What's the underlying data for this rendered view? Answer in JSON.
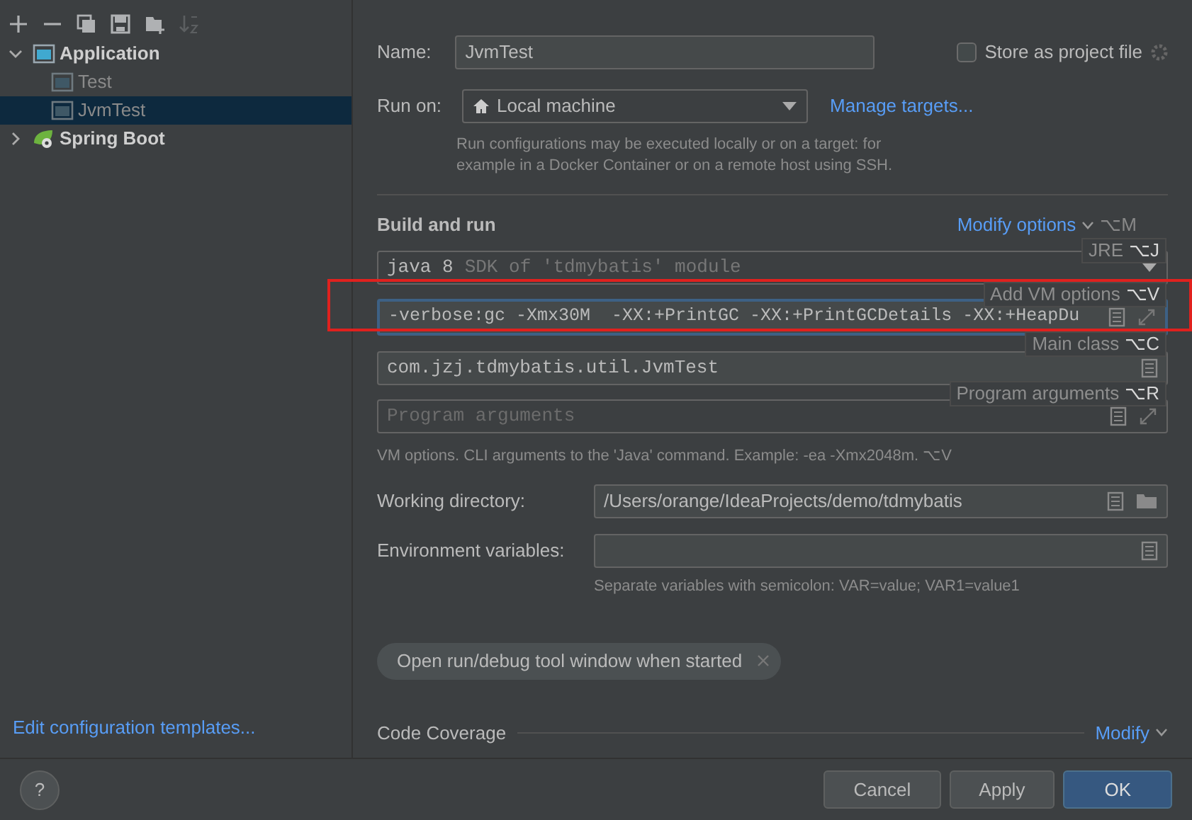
{
  "toolbar": [
    {
      "kind": "add",
      "disabled": false
    },
    {
      "kind": "remove",
      "disabled": false
    },
    {
      "kind": "copy",
      "disabled": false
    },
    {
      "kind": "save",
      "disabled": false
    },
    {
      "kind": "folder",
      "disabled": false
    },
    {
      "kind": "sort",
      "disabled": true
    }
  ],
  "tree": [
    {
      "label": "Application",
      "kind": "application",
      "expanded": true,
      "children": [
        {
          "label": "Test",
          "kind": "application",
          "selected": false
        },
        {
          "label": "JvmTest",
          "kind": "application",
          "selected": true
        }
      ]
    },
    {
      "label": "Spring Boot",
      "kind": "spring",
      "expanded": false
    }
  ],
  "templates_link": "Edit configuration templates...",
  "name": {
    "label": "Name:",
    "value": "JvmTest"
  },
  "store": {
    "label": "Store as project file",
    "checked": false
  },
  "run_on": {
    "label": "Run on:",
    "value": "Local machine",
    "link": "Manage targets...",
    "hint": "Run configurations may be executed locally or on a target: for example in a Docker Container or on a remote host using SSH."
  },
  "build": {
    "title": "Build and run",
    "modify": "Modify options",
    "modify_shortcut": "⌥M",
    "jre_value": "java 8",
    "jre_hint": "SDK of 'tdmybatis' module",
    "vm_options": "-verbose:gc -Xmx30M  -XX:+PrintGC -XX:+PrintGCDetails -XX:+HeapDu",
    "main_class": "com.jzj.tdmybatis.util.JvmTest",
    "program_args_placeholder": "Program arguments",
    "vm_help": "VM options. CLI arguments to the 'Java' command. Example: -ea -Xmx2048m. ⌥V"
  },
  "hints": [
    {
      "label": "JRE",
      "shortcut": "⌥J"
    },
    {
      "label": "Add VM options",
      "shortcut": "⌥V"
    },
    {
      "label": "Main class",
      "shortcut": "⌥C"
    },
    {
      "label": "Program arguments",
      "shortcut": "⌥R"
    }
  ],
  "working_dir": {
    "label": "Working directory:",
    "value": "/Users/orange/IdeaProjects/demo/tdmybatis"
  },
  "env_vars": {
    "label": "Environment variables:",
    "hint": "Separate variables with semicolon: VAR=value; VAR1=value1"
  },
  "chips": [
    {
      "label": "Open run/debug tool window when started"
    }
  ],
  "code_coverage": {
    "title": "Code Coverage",
    "link": "Modify"
  },
  "footer": {
    "help": "?",
    "buttons": [
      {
        "label": "Cancel",
        "primary": false
      },
      {
        "label": "Apply",
        "primary": false
      },
      {
        "label": "OK",
        "primary": true
      }
    ]
  }
}
